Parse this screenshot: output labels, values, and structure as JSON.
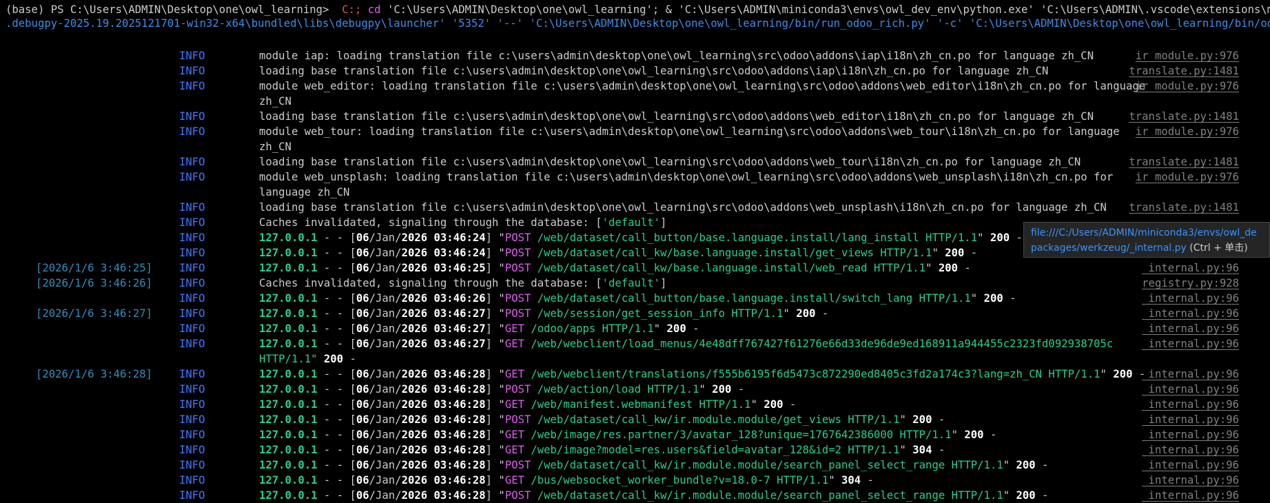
{
  "command": {
    "line1_prefix": "(base) PS C:\\Users\\ADMIN\\Desktop\\one\\owl_learning>",
    "line1_kw": "C:;",
    "line1_cd": "cd",
    "line1_rest": "'C:\\Users\\ADMIN\\Desktop\\one\\owl_learning'; & 'C:\\Users\\ADMIN\\miniconda3\\envs\\owl_dev_env\\python.exe' 'C:\\Users\\ADMIN\\.vscode\\extensions\\ms-python",
    "line2": ".debugpy-2025.19.2025121701-win32-x64\\bundled\\libs\\debugpy\\launcher' '5352' '--' 'C:\\Users\\ADMIN\\Desktop\\one\\owl_learning/bin/run_odoo_rich.py' '-c' 'C:\\Users\\ADMIN\\Desktop\\one\\owl_learning/bin/odoo.conf'"
  },
  "logs": [
    {
      "ts": "",
      "level": "INFO",
      "msg": "module iap: loading translation file c:\\users\\admin\\desktop\\one\\owl_learning\\src\\odoo\\addons\\iap\\i18n\\zh_cn.po for language zh_CN",
      "src": "ir_module.py:976"
    },
    {
      "ts": "",
      "level": "INFO",
      "msg": "loading base translation file c:\\users\\admin\\desktop\\one\\owl_learning\\src\\odoo\\addons\\iap\\i18n\\zh_cn.po for language zh_CN",
      "src": "translate.py:1481"
    },
    {
      "ts": "",
      "level": "INFO",
      "msg": "module web_editor: loading translation file c:\\users\\admin\\desktop\\one\\owl_learning\\src\\odoo\\addons\\web_editor\\i18n\\zh_cn.po for language",
      "src": "ir_module.py:976"
    },
    {
      "ts": "",
      "level": "",
      "msg": "zh_CN",
      "src": ""
    },
    {
      "ts": "",
      "level": "INFO",
      "msg": "loading base translation file c:\\users\\admin\\desktop\\one\\owl_learning\\src\\odoo\\addons\\web_editor\\i18n\\zh_cn.po for language zh_CN",
      "src": "translate.py:1481"
    },
    {
      "ts": "",
      "level": "INFO",
      "msg": "module web_tour: loading translation file c:\\users\\admin\\desktop\\one\\owl_learning\\src\\odoo\\addons\\web_tour\\i18n\\zh_cn.po for language",
      "src": "ir_module.py:976"
    },
    {
      "ts": "",
      "level": "",
      "msg": "zh_CN",
      "src": ""
    },
    {
      "ts": "",
      "level": "INFO",
      "msg": "loading base translation file c:\\users\\admin\\desktop\\one\\owl_learning\\src\\odoo\\addons\\web_tour\\i18n\\zh_cn.po for language zh_CN",
      "src": "translate.py:1481"
    },
    {
      "ts": "",
      "level": "INFO",
      "msg": "module web_unsplash: loading translation file c:\\users\\admin\\desktop\\one\\owl_learning\\src\\odoo\\addons\\web_unsplash\\i18n\\zh_cn.po for",
      "src": "ir_module.py:976"
    },
    {
      "ts": "",
      "level": "",
      "msg": "language zh_CN",
      "src": ""
    },
    {
      "ts": "",
      "level": "INFO",
      "msg": "loading base translation file c:\\users\\admin\\desktop\\one\\owl_learning\\src\\odoo\\addons\\web_unsplash\\i18n\\zh_cn.po for language zh_CN",
      "src": "translate.py:1481"
    },
    {
      "ts": "",
      "level": "INFO",
      "msg": "Caches invalidated, signaling through the database: ['default']",
      "src": ""
    },
    {
      "ts": "",
      "level": "INFO",
      "http": {
        "ip": "127.0.0.1",
        "day": "06",
        "mon": "Jan",
        "year": "2026",
        "time": "03:46:24",
        "method": "POST",
        "path": "/web/dataset/call_button/base.language.install/lang_install HTTP/1.1",
        "status": "200"
      },
      "src": ""
    },
    {
      "ts": "",
      "level": "INFO",
      "http": {
        "ip": "127.0.0.1",
        "day": "06",
        "mon": "Jan",
        "year": "2026",
        "time": "03:46:24",
        "method": "POST",
        "path": "/web/dataset/call_kw/base.language.install/get_views HTTP/1.1",
        "status": "200"
      },
      "src": ""
    },
    {
      "ts": "[2026/1/6 3:46:25]",
      "level": "INFO",
      "http": {
        "ip": "127.0.0.1",
        "day": "06",
        "mon": "Jan",
        "year": "2026",
        "time": "03:46:25",
        "method": "POST",
        "path": "/web/dataset/call_kw/base.language.install/web_read HTTP/1.1",
        "status": "200"
      },
      "src": "_internal.py:96"
    },
    {
      "ts": "[2026/1/6 3:46:26]",
      "level": "INFO",
      "msg": "Caches invalidated, signaling through the database: ['default']",
      "src": "registry.py:928"
    },
    {
      "ts": "",
      "level": "INFO",
      "http": {
        "ip": "127.0.0.1",
        "day": "06",
        "mon": "Jan",
        "year": "2026",
        "time": "03:46:26",
        "method": "POST",
        "path": "/web/dataset/call_button/base.language.install/switch_lang HTTP/1.1",
        "status": "200"
      },
      "src": "_internal.py:96"
    },
    {
      "ts": "[2026/1/6 3:46:27]",
      "level": "INFO",
      "http": {
        "ip": "127.0.0.1",
        "day": "06",
        "mon": "Jan",
        "year": "2026",
        "time": "03:46:27",
        "method": "POST",
        "path": "/web/session/get_session_info HTTP/1.1",
        "status": "200"
      },
      "src": "_internal.py:96"
    },
    {
      "ts": "",
      "level": "INFO",
      "http": {
        "ip": "127.0.0.1",
        "day": "06",
        "mon": "Jan",
        "year": "2026",
        "time": "03:46:27",
        "method": "GET",
        "path": "/odoo/apps HTTP/1.1",
        "status": "200"
      },
      "src": "_internal.py:96"
    },
    {
      "ts": "",
      "level": "INFO",
      "http": {
        "ip": "127.0.0.1",
        "day": "06",
        "mon": "Jan",
        "year": "2026",
        "time": "03:46:27",
        "method": "GET",
        "path": "/web/webclient/load_menus/4e48dff767427f61276e66d33de96de9ed168911a944455c2323fd092938705c",
        "status": "",
        "noend": true
      },
      "src": "_internal.py:96"
    },
    {
      "ts": "",
      "level": "",
      "cont": {
        "text": "HTTP/1.1\"",
        "status": "200"
      },
      "src": ""
    },
    {
      "ts": "[2026/1/6 3:46:28]",
      "level": "INFO",
      "http": {
        "ip": "127.0.0.1",
        "day": "06",
        "mon": "Jan",
        "year": "2026",
        "time": "03:46:28",
        "method": "GET",
        "path": "/web/webclient/translations/f555b6195f6d5473c872290ed8405c3fd2a174c3?lang=zh_CN HTTP/1.1",
        "status": "200"
      },
      "src": "_internal.py:96"
    },
    {
      "ts": "",
      "level": "INFO",
      "http": {
        "ip": "127.0.0.1",
        "day": "06",
        "mon": "Jan",
        "year": "2026",
        "time": "03:46:28",
        "method": "POST",
        "path": "/web/action/load HTTP/1.1",
        "status": "200"
      },
      "src": "_internal.py:96"
    },
    {
      "ts": "",
      "level": "INFO",
      "http": {
        "ip": "127.0.0.1",
        "day": "06",
        "mon": "Jan",
        "year": "2026",
        "time": "03:46:28",
        "method": "GET",
        "path": "/web/manifest.webmanifest HTTP/1.1",
        "status": "200"
      },
      "src": "_internal.py:96"
    },
    {
      "ts": "",
      "level": "INFO",
      "http": {
        "ip": "127.0.0.1",
        "day": "06",
        "mon": "Jan",
        "year": "2026",
        "time": "03:46:28",
        "method": "POST",
        "path": "/web/dataset/call_kw/ir.module.module/get_views HTTP/1.1",
        "status": "200"
      },
      "src": "_internal.py:96"
    },
    {
      "ts": "",
      "level": "INFO",
      "http": {
        "ip": "127.0.0.1",
        "day": "06",
        "mon": "Jan",
        "year": "2026",
        "time": "03:46:28",
        "method": "GET",
        "path": "/web/image/res.partner/3/avatar_128?unique=1767642386000 HTTP/1.1",
        "status": "200"
      },
      "src": "_internal.py:96"
    },
    {
      "ts": "",
      "level": "INFO",
      "http": {
        "ip": "127.0.0.1",
        "day": "06",
        "mon": "Jan",
        "year": "2026",
        "time": "03:46:28",
        "method": "GET",
        "path": "/web/image?model=res.users&field=avatar_128&id=2 HTTP/1.1",
        "status": "304"
      },
      "src": "_internal.py:96"
    },
    {
      "ts": "",
      "level": "INFO",
      "http": {
        "ip": "127.0.0.1",
        "day": "06",
        "mon": "Jan",
        "year": "2026",
        "time": "03:46:28",
        "method": "POST",
        "path": "/web/dataset/call_kw/ir.module.module/search_panel_select_range HTTP/1.1",
        "status": "200"
      },
      "src": "_internal.py:96"
    },
    {
      "ts": "",
      "level": "INFO",
      "http": {
        "ip": "127.0.0.1",
        "day": "06",
        "mon": "Jan",
        "year": "2026",
        "time": "03:46:28",
        "method": "GET",
        "path": "/bus/websocket_worker_bundle?v=18.0-7 HTTP/1.1",
        "status": "304"
      },
      "src": "_internal.py:96"
    },
    {
      "ts": "",
      "level": "INFO",
      "http": {
        "ip": "127.0.0.1",
        "day": "06",
        "mon": "Jan",
        "year": "2026",
        "time": "03:46:28",
        "method": "POST",
        "path": "/web/dataset/call_kw/ir.module.module/search_panel_select_range HTTP/1.1",
        "status": "200"
      },
      "src": "_internal.py:96"
    }
  ],
  "tooltip": {
    "line1": "file:///C:/Users/ADMIN/miniconda3/envs/owl_de",
    "line2": "packages/werkzeug/_internal.py",
    "hint": "(Ctrl + 单击)"
  }
}
